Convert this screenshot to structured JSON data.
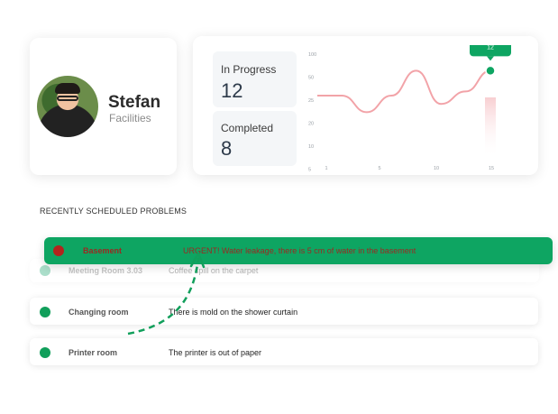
{
  "profile": {
    "name": "Stefan",
    "role": "Facilities"
  },
  "stats": {
    "in_progress_label": "In Progress",
    "in_progress_value": "12",
    "completed_label": "Completed",
    "completed_value": "8"
  },
  "chart_data": {
    "type": "line",
    "x": [
      1,
      3,
      5,
      7,
      9,
      11,
      13,
      15
    ],
    "series": [
      {
        "values": [
          15,
          15,
          11,
          15,
          21,
          13,
          16,
          21
        ]
      }
    ],
    "y_ticks": [
      "100",
      "50",
      "25",
      "20",
      "10",
      "5"
    ],
    "x_ticks": [
      "1",
      "5",
      "10",
      "15"
    ],
    "highlight": {
      "x": 15,
      "label": "12"
    },
    "colors": {
      "line": "#f2a3a8",
      "marker": "#0ea562"
    }
  },
  "section_title": "RECENTLY SCHEDULED PROBLEMS",
  "problems": [
    {
      "room": "Basement",
      "description": "URGENT! Water leakage, there is 5 cm of water in the basement",
      "status_color": "#b3241d"
    },
    {
      "room": "Meeting Room 3.03",
      "description": "Coffee spill on the carpet",
      "status_color": "#11a36a"
    },
    {
      "room": "Changing room",
      "description": "There is mold on the shower curtain",
      "status_color": "#119f5b"
    },
    {
      "room": "Printer room",
      "description": "The printer is out of paper",
      "status_color": "#119f5b"
    }
  ],
  "colors": {
    "accent": "#0ea562",
    "urgent": "#b3241d"
  }
}
